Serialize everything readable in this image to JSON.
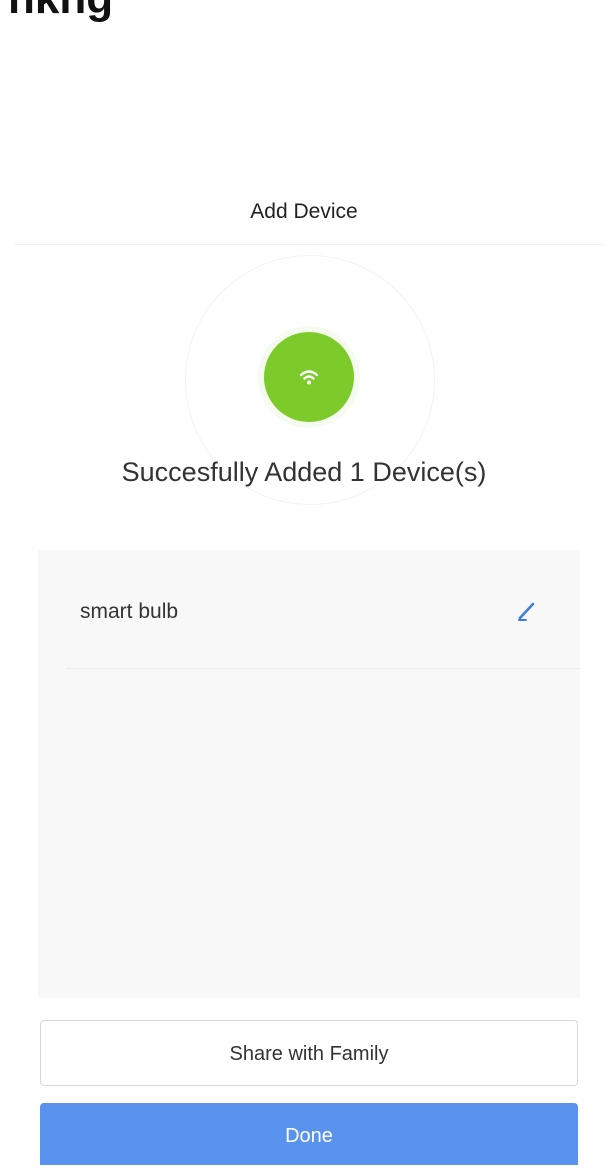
{
  "top_cut_text": "nkng",
  "header": {
    "title": "Add Device"
  },
  "status": {
    "icon": "wifi-icon",
    "accent_color": "#7dcb2b",
    "message": "Succesfully Added 1 Device(s)"
  },
  "devices": [
    {
      "name": "smart bulb",
      "edit_icon": "pencil-icon"
    }
  ],
  "actions": {
    "share_label": "Share with Family",
    "done_label": "Done",
    "done_color": "#5a93ed"
  }
}
